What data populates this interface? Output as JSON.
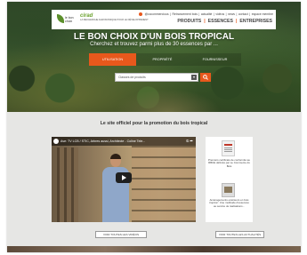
{
  "header": {
    "logo_left_text": "le bon choix",
    "logo_right_name": "cirad",
    "logo_right_tagline": "LA RECHERCHE AGRONOMIQUE POUR LE DÉVELOPPEMENT",
    "top_links": [
      "@cccommercious",
      "Retrancement bois",
      "actualité",
      "vidéos",
      "news",
      "contact",
      "espace membre"
    ],
    "main_nav": [
      "PRODUITS",
      "ESSENCES",
      "ENTREPRISES"
    ]
  },
  "hero": {
    "title": "LE BON CHOIX D'UN BOIS TROPICAL",
    "subtitle": "Cherchez et trouvez parmi plus de 30 essences par ...",
    "tabs": [
      "UTILISATION",
      "PROPRIÉTÉ",
      "FOURNISSEUR"
    ],
    "active_tab": "UTILISATION",
    "search_placeholder": "Classes de produits"
  },
  "content": {
    "section_title": "Le site officiel pour la promotion du bois tropical",
    "video_title": "Ave: TV LCB / STIC, Arbres aussi, Architecte - Coline Tele...",
    "news": [
      {
        "caption": "Premiers certificats de conformité au RBUE délivrés par Le Commerce du Bois"
      },
      {
        "caption": "Aménagements extérieurs en bois tropical : Une multitude d'essences au service de réalisations..."
      }
    ],
    "videos_button": "VOIR TOUTES LES VIDÉOS",
    "news_button": "VOIR TOUTES LES ACTUALITÉS"
  },
  "colors": {
    "accent": "#e8581c",
    "logo_green": "#6aa12c"
  }
}
